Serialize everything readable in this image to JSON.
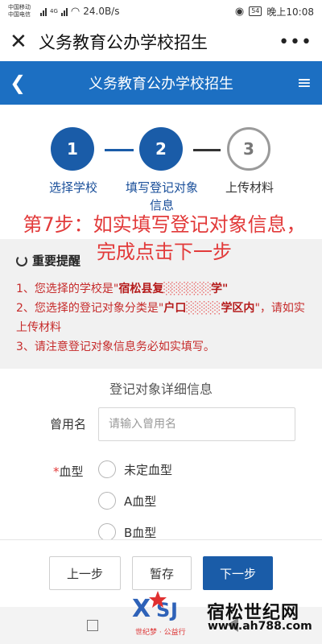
{
  "status_bar": {
    "carrier_1": "中国移动",
    "carrier_2": "中国电信",
    "network": "4G",
    "speed": "24.0B/s",
    "battery": "54",
    "time": "晚上10:08"
  },
  "browser": {
    "title": "义务教育公办学校招生"
  },
  "app_header": {
    "title": "义务教育公办学校招生"
  },
  "steps": [
    {
      "number": "1",
      "label": "选择学校",
      "state": "done"
    },
    {
      "number": "2",
      "label": "填写登记对象\n信息",
      "state": "current"
    },
    {
      "number": "3",
      "label": "上传材料",
      "state": "todo"
    }
  ],
  "annotation": "第7步：如实填写登记对象信息，\n完成点击下一步",
  "notice": {
    "heading": "重要提醒",
    "line1_prefix": "1、您选择的学校是\"",
    "line1_school": "宿松县复",
    "line1_suffix": "学\"",
    "line2_prefix": "2、您选择的登记对象分类是\"",
    "line2_category": "户口",
    "line2_category_tail": "学区内",
    "line2_suffix": "\"，请如实上传材料",
    "line3": "3、请注意登记对象信息务必如实填写。"
  },
  "form": {
    "section_title": "登记对象详细信息",
    "former_name_label": "曾用名",
    "former_name_placeholder": "请输入曾用名",
    "former_name_value": "",
    "blood_type_required": "*",
    "blood_type_label": "血型",
    "blood_type_options": [
      "未定血型",
      "A血型",
      "B血型"
    ]
  },
  "buttons": {
    "prev": "上一步",
    "save": "暂存",
    "next": "下一步"
  },
  "watermark": {
    "site_name": "宿松世纪网",
    "url": "www.ah788.com",
    "logo_text": "世纪梦 · 公益行"
  },
  "colors": {
    "header_blue": "#1c6fc2",
    "step_blue": "#1a5ca8",
    "annotation_red": "#e23a3a",
    "notice_red": "#c62b2b"
  }
}
